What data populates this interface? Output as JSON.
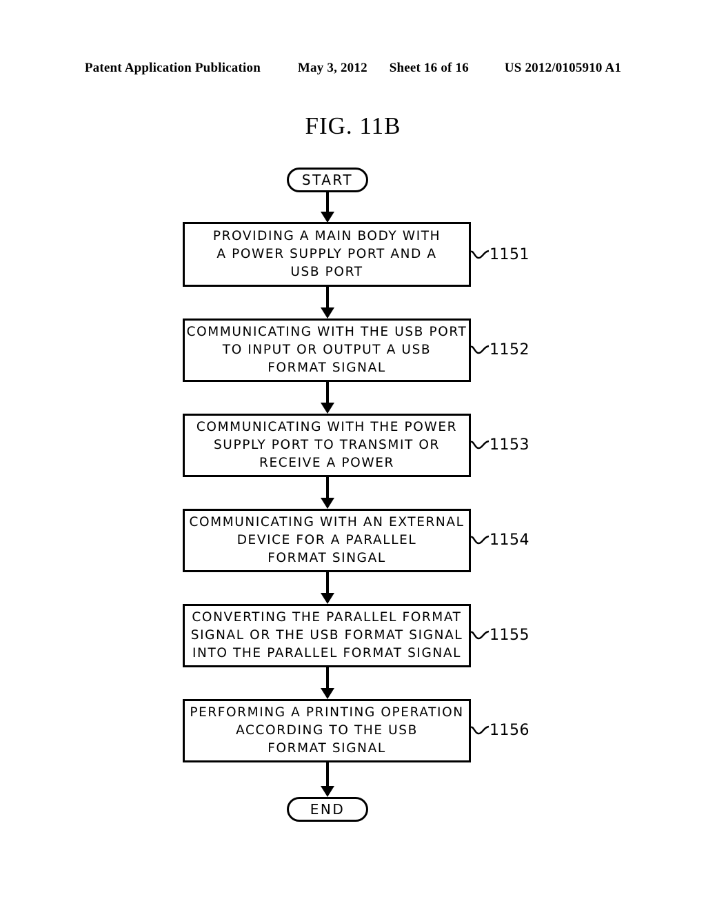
{
  "header": {
    "publication": "Patent Application Publication",
    "date": "May 3, 2012",
    "sheet": "Sheet 16 of 16",
    "patent_number": "US 2012/0105910 A1"
  },
  "figure": {
    "title": "FIG. 11B"
  },
  "flowchart": {
    "start_label": "START",
    "end_label": "END",
    "steps": [
      {
        "ref": "1151",
        "lines": [
          "PROVIDING A MAIN BODY WITH",
          "A POWER SUPPLY PORT AND A",
          "USB PORT"
        ]
      },
      {
        "ref": "1152",
        "lines": [
          "COMMUNICATING WITH THE USB PORT",
          "TO INPUT OR OUTPUT A USB",
          "FORMAT SIGNAL"
        ]
      },
      {
        "ref": "1153",
        "lines": [
          "COMMUNICATING WITH THE POWER",
          "SUPPLY PORT TO TRANSMIT OR",
          "RECEIVE A POWER"
        ]
      },
      {
        "ref": "1154",
        "lines": [
          "COMMUNICATING WITH AN EXTERNAL",
          "DEVICE FOR A PARALLEL",
          "FORMAT SINGAL"
        ]
      },
      {
        "ref": "1155",
        "lines": [
          "CONVERTING THE PARALLEL FORMAT",
          "SIGNAL OR THE USB FORMAT SIGNAL",
          "INTO THE PARALLEL FORMAT SIGNAL"
        ]
      },
      {
        "ref": "1156",
        "lines": [
          "PERFORMING A PRINTING OPERATION",
          "ACCORDING TO THE USB",
          "FORMAT SIGNAL"
        ]
      }
    ]
  },
  "colors": {
    "ink": "#000000",
    "paper": "#ffffff"
  }
}
